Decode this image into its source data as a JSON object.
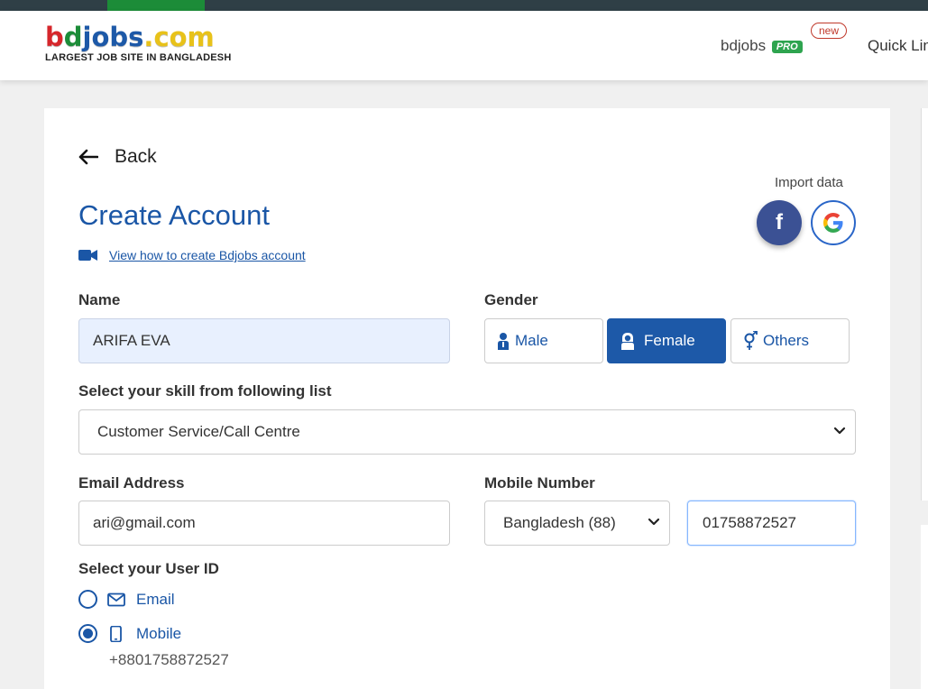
{
  "header": {
    "logo_parts": [
      "b",
      "d",
      "jobs",
      ".com"
    ],
    "logo_tagline": "LARGEST JOB SITE IN BANGLADESH",
    "pro_link_text": "bdjobs",
    "pro_badge": "PRO",
    "new_badge": "new",
    "quick_links": "Quick Lin"
  },
  "form": {
    "back_label": "Back",
    "title": "Create Account",
    "video_link": "View how to create Bdjobs account",
    "import_label": "Import data",
    "name_label": "Name",
    "name_value": "ARIFA EVA",
    "gender_label": "Gender",
    "gender_options": [
      "Male",
      "Female",
      "Others"
    ],
    "gender_selected": "Female",
    "skill_label": "Select your skill from following list",
    "skill_value": "Customer Service/Call Centre",
    "email_label": "Email Address",
    "email_value": "ari@gmail.com",
    "mobile_label": "Mobile Number",
    "country_value": "Bangladesh (88)",
    "mobile_value": "01758872527",
    "userid_label": "Select your User ID",
    "userid_options": [
      "Email",
      "Mobile"
    ],
    "userid_selected": "Mobile",
    "mobile_echo": "+8801758872527"
  },
  "colors": {
    "primary": "#1a56a6",
    "header_bar": "#2f3f46",
    "accent_green": "#1c8c38",
    "facebook": "#3b5194"
  },
  "icons": [
    "arrow-left-icon",
    "video-camera-icon",
    "facebook-icon",
    "google-icon",
    "male-user-icon",
    "female-user-icon",
    "gender-symbol-icon",
    "envelope-icon",
    "mobile-phone-icon",
    "chevron-down-icon"
  ]
}
